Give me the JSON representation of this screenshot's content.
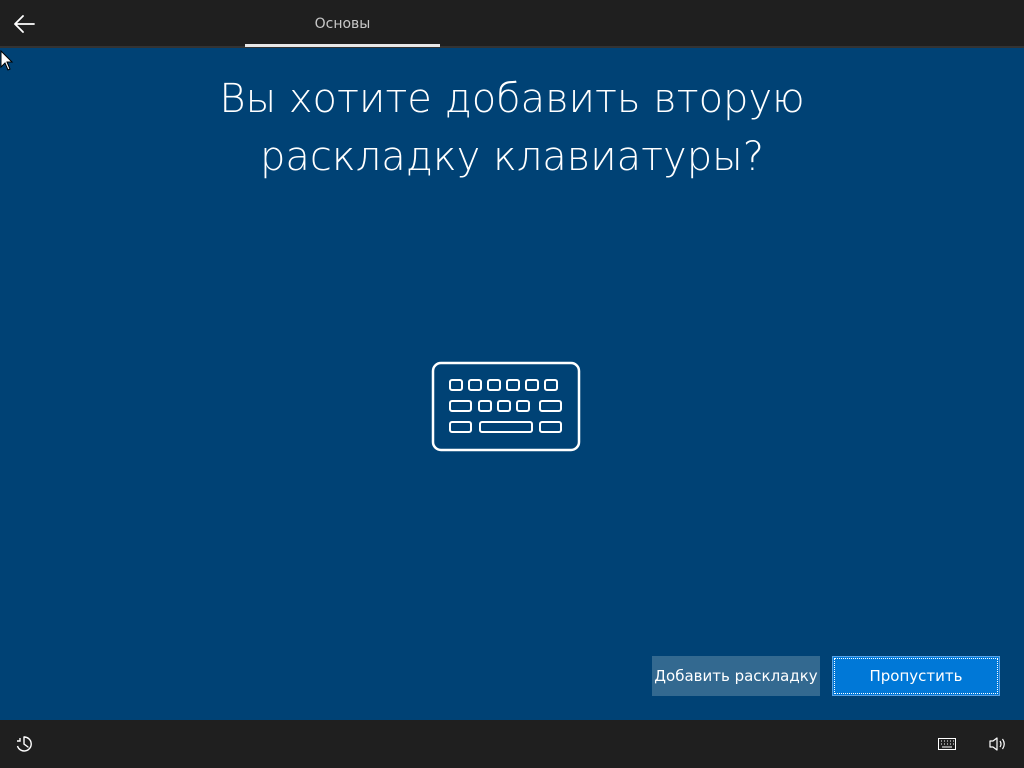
{
  "header": {
    "tab_label": "Основы",
    "back_icon": "arrow-left-icon"
  },
  "main": {
    "title": "Вы хотите добавить вторую раскладку клавиатуры?",
    "illustration_icon": "keyboard-icon"
  },
  "actions": {
    "add_layout_label": "Добавить раскладку",
    "skip_label": "Пропустить"
  },
  "footer": {
    "left_icon": "ease-of-access-icon",
    "keyboard_icon": "keyboard-icon",
    "volume_icon": "volume-icon"
  },
  "colors": {
    "background": "#004275",
    "bar": "#1f1f1f",
    "primary_button": "#0078d7",
    "secondary_button": "#336990"
  }
}
